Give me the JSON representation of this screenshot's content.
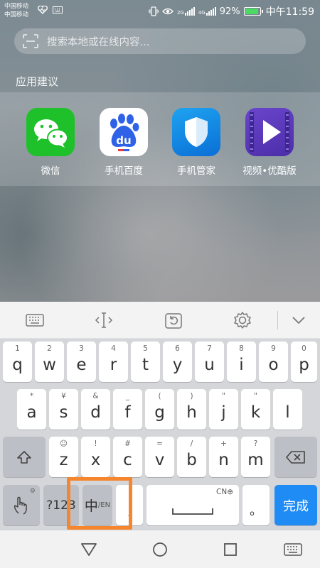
{
  "status_bar": {
    "carrier_1": "中国移动",
    "carrier_2": "中国移动",
    "net_1": "2G",
    "net_2": "4G",
    "battery": "92%",
    "time": "中午11:59"
  },
  "search": {
    "placeholder": "搜索本地或在线内容..."
  },
  "suggestions": {
    "title": "应用建议",
    "apps": [
      {
        "label": "微信",
        "icon": "wechat-icon"
      },
      {
        "label": "手机百度",
        "icon": "baidu-icon"
      },
      {
        "label": "手机管家",
        "icon": "phone-manager-icon"
      },
      {
        "label": "视频•优酷版",
        "icon": "video-youku-icon"
      }
    ]
  },
  "keyboard": {
    "row1": [
      {
        "key": "q",
        "sub": "1"
      },
      {
        "key": "w",
        "sub": "2"
      },
      {
        "key": "e",
        "sub": "3"
      },
      {
        "key": "r",
        "sub": "4"
      },
      {
        "key": "t",
        "sub": "5"
      },
      {
        "key": "y",
        "sub": "6"
      },
      {
        "key": "u",
        "sub": "7"
      },
      {
        "key": "i",
        "sub": "8"
      },
      {
        "key": "o",
        "sub": "9"
      },
      {
        "key": "p",
        "sub": "0"
      }
    ],
    "row2": [
      {
        "key": "a",
        "sub": "*"
      },
      {
        "key": "s",
        "sub": "¥"
      },
      {
        "key": "d",
        "sub": "&"
      },
      {
        "key": "f",
        "sub": "_"
      },
      {
        "key": "g",
        "sub": "("
      },
      {
        "key": "h",
        "sub": ")"
      },
      {
        "key": "j",
        "sub": "\""
      },
      {
        "key": "k",
        "sub": "\""
      },
      {
        "key": "l",
        "sub": ""
      }
    ],
    "row3": [
      {
        "key": "z",
        "sub": "☺"
      },
      {
        "key": "x",
        "sub": "!"
      },
      {
        "key": "c",
        "sub": "#"
      },
      {
        "key": "v",
        "sub": "="
      },
      {
        "key": "b",
        "sub": "/"
      },
      {
        "key": "n",
        "sub": "+"
      },
      {
        "key": "m",
        "sub": "?"
      }
    ],
    "numbers_label": "?123",
    "lang_main": "中",
    "lang_sub": "/EN",
    "space_label": "CN",
    "period": "。",
    "done_label": "完成"
  }
}
